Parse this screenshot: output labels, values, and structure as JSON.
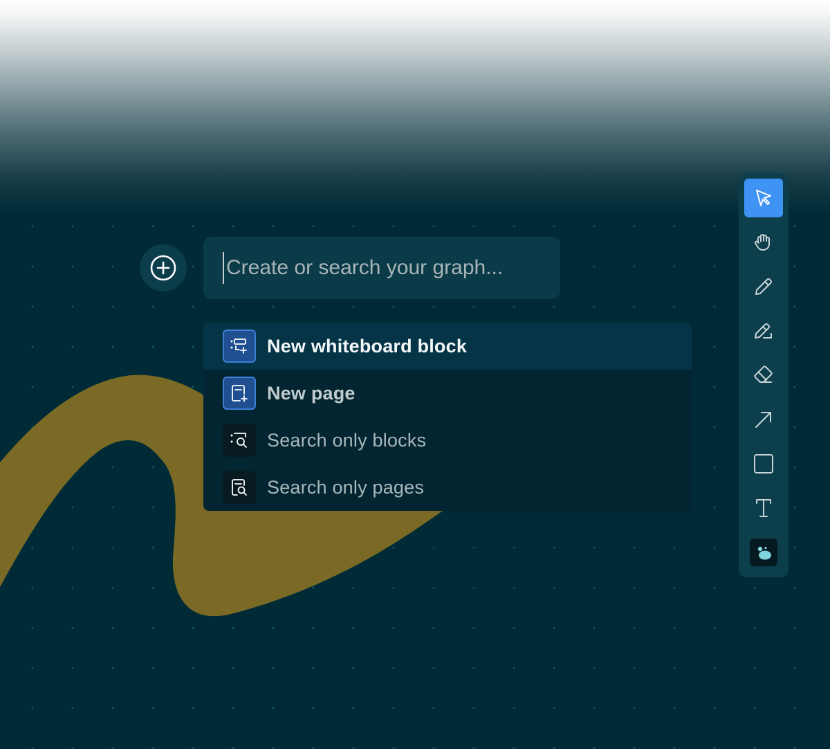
{
  "search": {
    "placeholder": "Create or search your graph...",
    "value": ""
  },
  "add_button": {
    "icon": "plus-circle-icon"
  },
  "menu": {
    "items": [
      {
        "label": "New whiteboard block",
        "icon": "whiteboard-block-add-icon",
        "active": true
      },
      {
        "label": "New page",
        "icon": "page-add-icon",
        "active": false
      },
      {
        "label": "Search only blocks",
        "icon": "block-search-icon",
        "active": false
      },
      {
        "label": "Search only pages",
        "icon": "page-search-icon",
        "active": false
      }
    ]
  },
  "toolbar": {
    "tools": [
      {
        "name": "select",
        "icon": "cursor-arrow-icon",
        "selected": true
      },
      {
        "name": "pan",
        "icon": "hand-icon",
        "selected": false
      },
      {
        "name": "pen",
        "icon": "pencil-icon",
        "selected": false
      },
      {
        "name": "highlighter",
        "icon": "highlighter-icon",
        "selected": false
      },
      {
        "name": "eraser",
        "icon": "eraser-icon",
        "selected": false
      },
      {
        "name": "connector",
        "icon": "arrow-icon",
        "selected": false
      },
      {
        "name": "rectangle",
        "icon": "square-icon",
        "selected": false
      },
      {
        "name": "text",
        "icon": "text-icon",
        "selected": false
      },
      {
        "name": "logseq",
        "icon": "logseq-logo-icon",
        "selected": false
      }
    ]
  },
  "colors": {
    "background": "#002b36",
    "accent": "#3f93f5",
    "stroke": "#7a6a25",
    "menu_active": "#053447"
  }
}
